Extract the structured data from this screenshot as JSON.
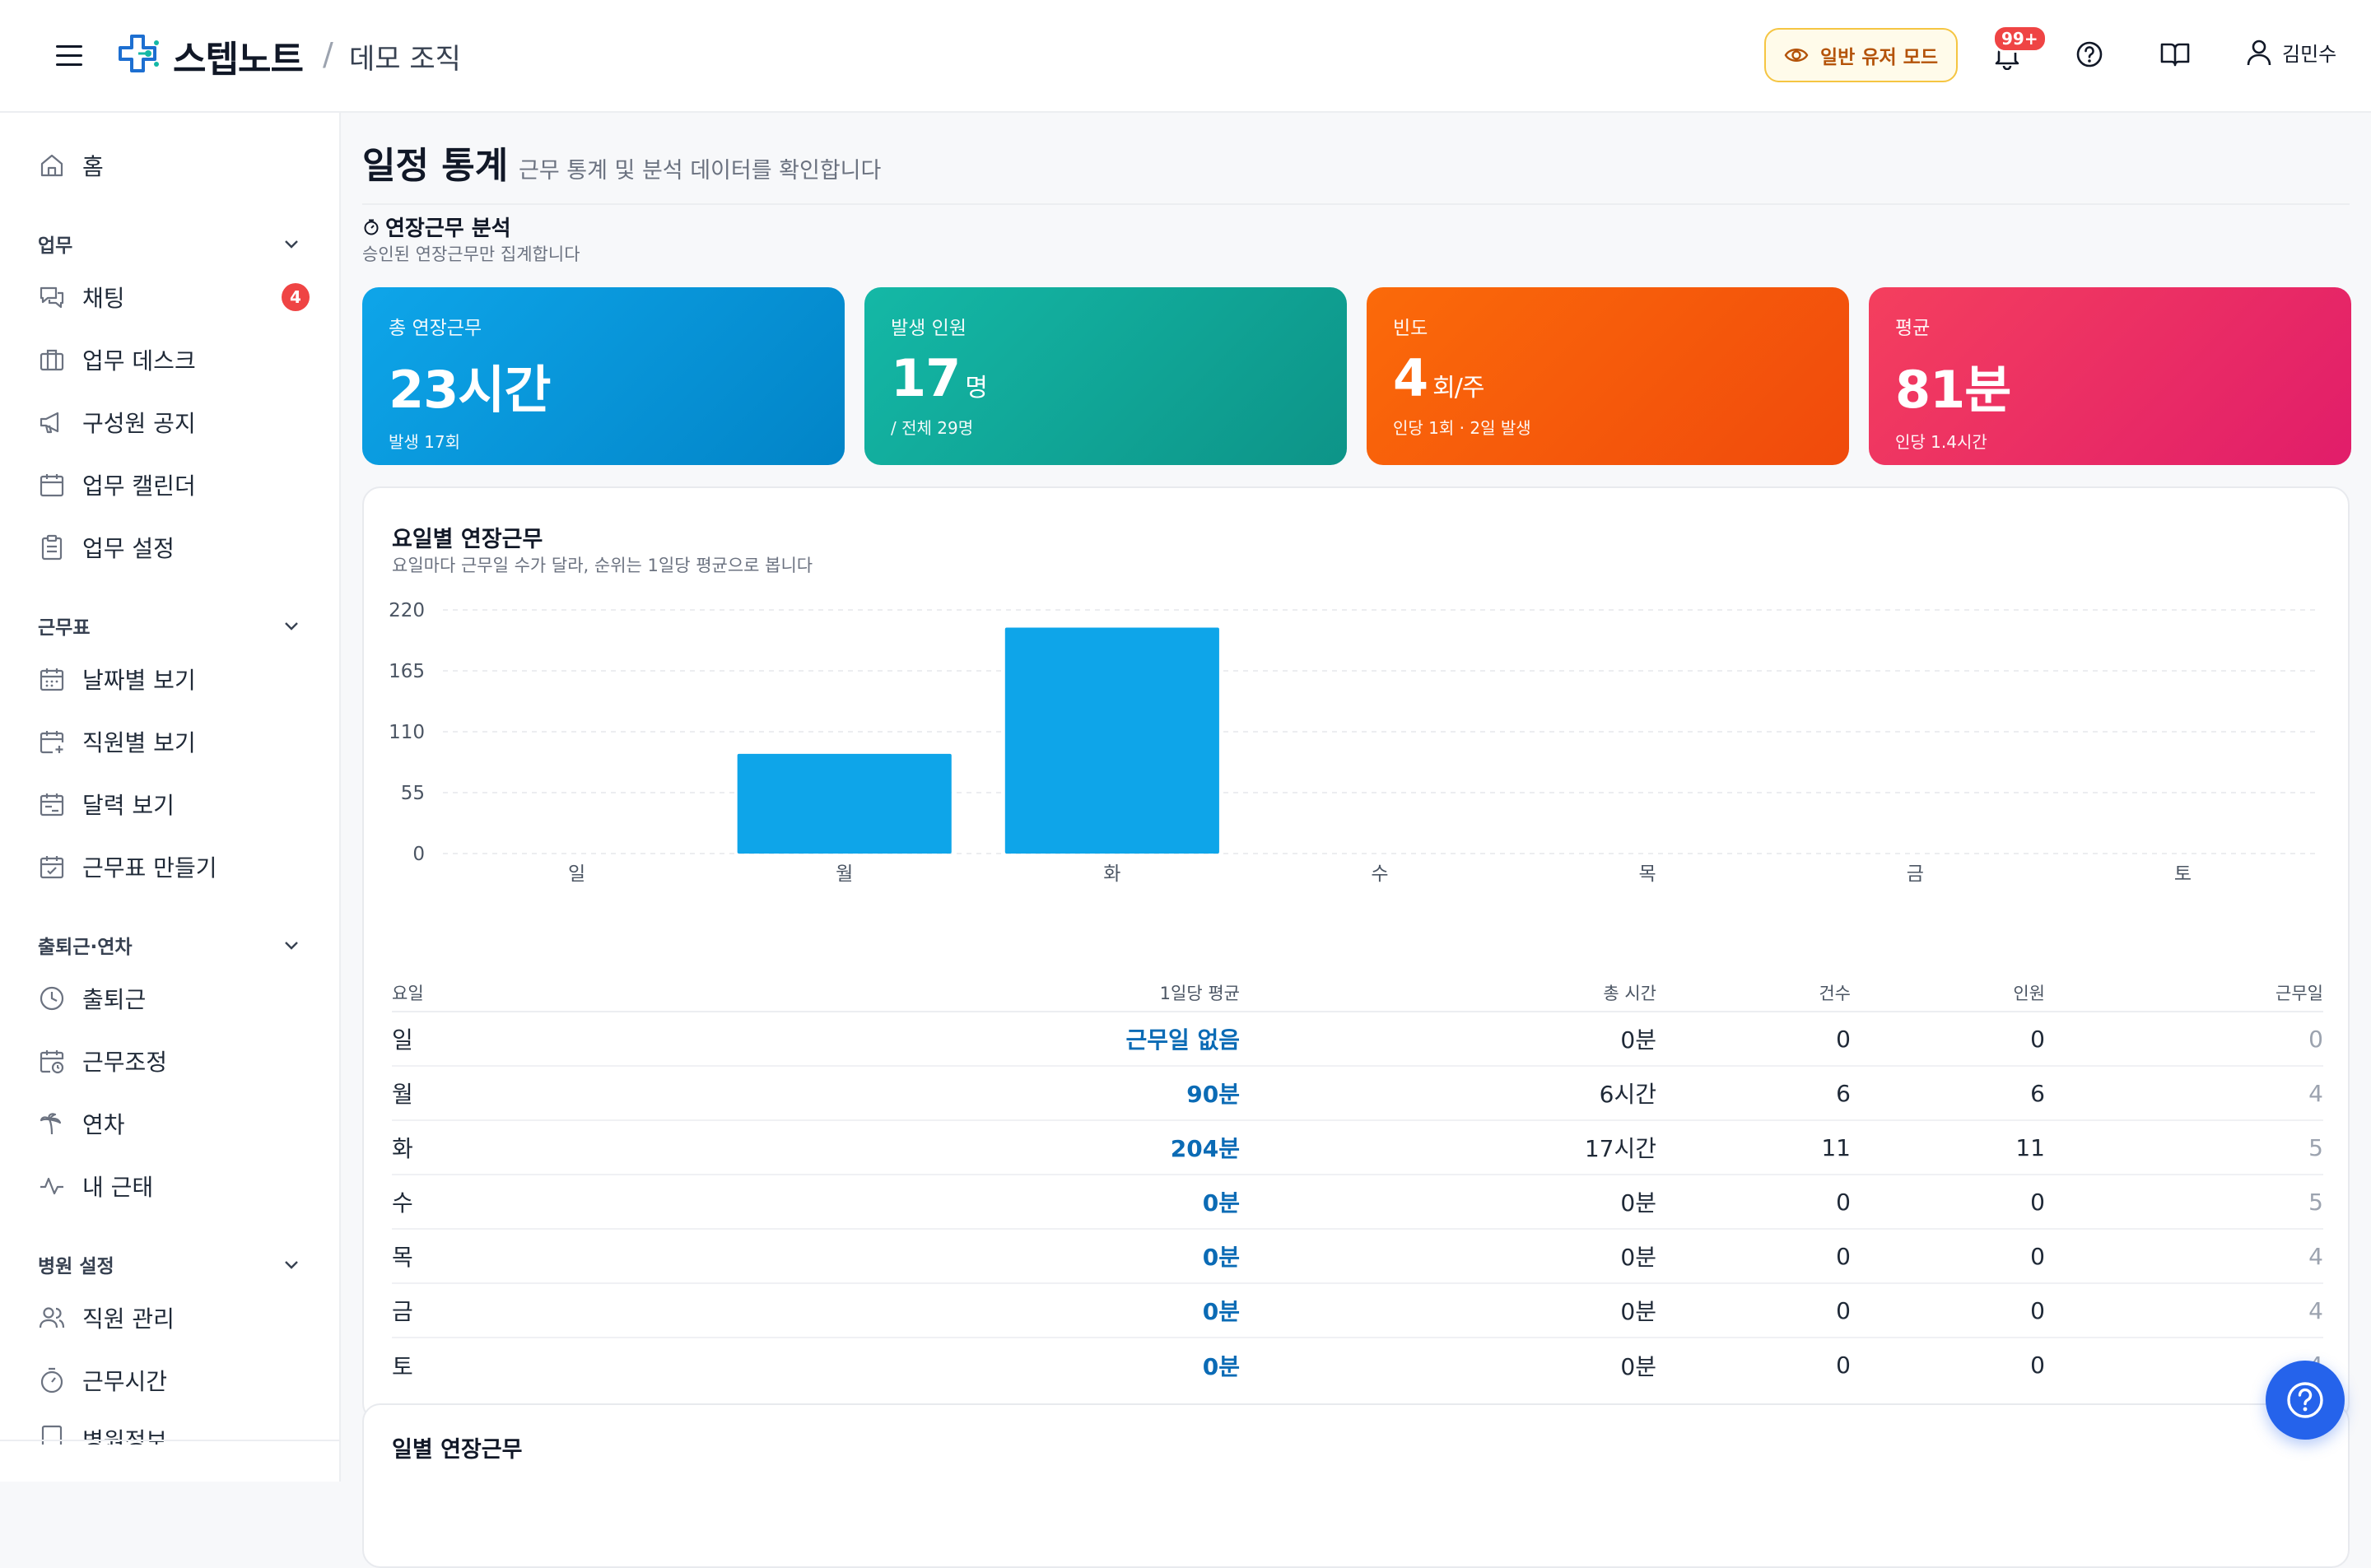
{
  "header": {
    "brand": "스텝노트",
    "org": "데모 조직",
    "mode_label": "일반 유저 모드",
    "notification_badge": "99+",
    "user_name": "김민수",
    "icons": [
      "menu-icon",
      "logo-icon",
      "eye-icon",
      "bell-icon",
      "help-icon",
      "book-icon",
      "user-icon"
    ]
  },
  "sidebar": {
    "home": "홈",
    "sections": [
      {
        "title": "업무",
        "items": [
          "채팅",
          "업무 데스크",
          "구성원 공지",
          "업무 캘린더",
          "업무 설정"
        ]
      },
      {
        "title": "근무표",
        "items": [
          "날짜별 보기",
          "직원별 보기",
          "달력 보기",
          "근무표 만들기"
        ]
      },
      {
        "title": "출퇴근·연차",
        "items": [
          "출퇴근",
          "근무조정",
          "연차",
          "내 근태"
        ]
      },
      {
        "title": "병원 설정",
        "items": [
          "직원 관리",
          "근무시간",
          "병원정보"
        ]
      }
    ],
    "chat_badge": "4"
  },
  "page": {
    "title": "일정 통계",
    "subtitle": "근무 통계 및 분석 데이터를 확인합니다",
    "section_title": "연장근무 분석",
    "section_sub": "승인된 연장근무만 집계합니다"
  },
  "cards": [
    {
      "label": "총 연장근무",
      "value": "23시간",
      "unit": "",
      "note": "발생 17회",
      "color1": "#0ea5e9",
      "color2": "#0284c7"
    },
    {
      "label": "발생 인원",
      "value": "17",
      "unit": "명",
      "note": "/ 전체 29명",
      "color1": "#14b8a6",
      "color2": "#0d9488"
    },
    {
      "label": "빈도",
      "value": "4",
      "unit": "회/주",
      "note": "인당 1회 · 2일 발생",
      "color1": "#fb6a0a",
      "color2": "#f04a0c"
    },
    {
      "label": "평균",
      "value": "81분",
      "unit": "",
      "note": "인당 1.4시간",
      "color1": "#f43f5e",
      "color2": "#e11d6a"
    }
  ],
  "panel": {
    "title": "요일별 연장근무",
    "subtitle": "요일마다 근무일 수가 달라, 순위는 1일당 평균으로 봅니다",
    "next_title": "일별 연장근무"
  },
  "chart_data": {
    "type": "bar",
    "categories": [
      "일",
      "월",
      "화",
      "수",
      "목",
      "금",
      "토"
    ],
    "values": [
      0,
      90,
      204,
      0,
      0,
      0,
      0
    ],
    "ylim": [
      0,
      220
    ],
    "yticks": [
      0,
      55,
      110,
      165,
      220
    ],
    "grid": true,
    "bar_color": "#0ea5e9"
  },
  "table": {
    "headers": [
      "요일",
      "1일당 평균",
      "총 시간",
      "건수",
      "인원",
      "근무일"
    ],
    "rows": [
      [
        "일",
        "근무일 없음",
        "0분",
        "0",
        "0",
        "0"
      ],
      [
        "월",
        "90분",
        "6시간",
        "6",
        "6",
        "4"
      ],
      [
        "화",
        "204분",
        "17시간",
        "11",
        "11",
        "5"
      ],
      [
        "수",
        "0분",
        "0분",
        "0",
        "0",
        "5"
      ],
      [
        "목",
        "0분",
        "0분",
        "0",
        "0",
        "4"
      ],
      [
        "금",
        "0분",
        "0분",
        "0",
        "0",
        "4"
      ],
      [
        "토",
        "0분",
        "0분",
        "0",
        "0",
        "4"
      ]
    ]
  }
}
